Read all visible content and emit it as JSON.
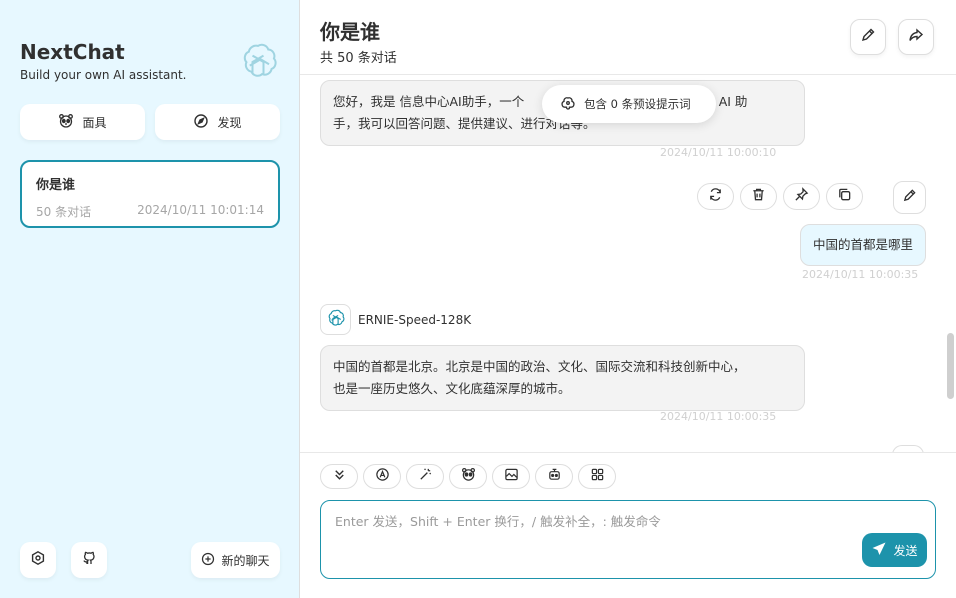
{
  "colors": {
    "primary": "#1d93ab",
    "sidebar_bg": "#e7f8ff",
    "bubble_user": "#e7f8ff",
    "bubble_bot": "#f3f3f3"
  },
  "sidebar": {
    "title": "NextChat",
    "subtitle": "Build your own AI assistant.",
    "mask_button": "面具",
    "discover_button": "发现",
    "chats": [
      {
        "title": "你是谁",
        "count": "50 条对话",
        "time": "2024/10/11 10:01:14"
      }
    ],
    "new_chat": "新的聊天"
  },
  "header": {
    "title": "你是谁",
    "subtitle": "共 50 条对话"
  },
  "prompt_hint": "包含 0 条预设提示词",
  "messages": [
    {
      "role": "assistant",
      "line1": "您好，我是 信息中心AI助手，一个",
      "line1_tail": "的 AI 助",
      "line2": "手，我可以回答问题、提供建议、进行对话等。",
      "time": "2024/10/11 10:00:10"
    },
    {
      "role": "user",
      "text": "中国的首都是哪里",
      "time": "2024/10/11 10:00:35"
    },
    {
      "role": "assistant",
      "model": "ERNIE-Speed-128K",
      "line1": "中国的首都是北京。北京是中国的政治、文化、国际交流和科技创新中心，",
      "line2": "也是一座历史悠久、文化底蕴深厚的城市。",
      "time": "2024/10/11 10:00:35"
    }
  ],
  "input": {
    "placeholder": "Enter 发送，Shift + Enter 换行，/ 触发补全，: 触发命令",
    "send_label": "发送"
  }
}
